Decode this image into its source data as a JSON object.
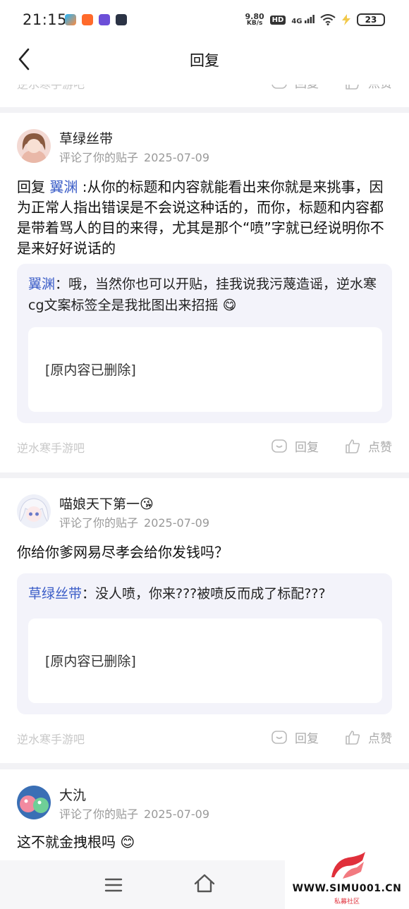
{
  "status": {
    "time": "21:15",
    "net_speed_value": "9.80",
    "net_speed_unit": "KB/s",
    "hd": "HD",
    "signal": "4G",
    "battery": "23"
  },
  "nav": {
    "title": "回复"
  },
  "top_footer": {
    "forum": "逆水寒手游吧",
    "reply": "回复",
    "like": "点赞"
  },
  "posts": [
    {
      "username": "草绿丝带",
      "action": "评论了你的贴子",
      "date": "2025-07-09",
      "body_prefix": "回复 ",
      "mention": "翼渊",
      "body_text": " :从你的标题和内容就能看出来你就是来挑事，因为正常人指出错误是不会说这种话的，而你，标题和内容都是带着骂人的目的来得，尤其是那个“喷”字就已经说明你不是来好好说话的",
      "quote_name": "翼渊",
      "quote_text": "：哦，当然你也可以开贴，挂我说我污蔑造谣，逆水寒cg文案标签全是我批图出来招摇",
      "quote_emoji": "😋",
      "original": "[原内容已删除]",
      "forum": "逆水寒手游吧",
      "reply": "回复",
      "like": "点赞"
    },
    {
      "username": "喵娘天下第一",
      "username_emoji": "😘",
      "action": "评论了你的贴子",
      "date": "2025-07-09",
      "body_text": "你给你爹网易尽孝会给你发钱吗？",
      "quote_name": "草绿丝带",
      "quote_text": "：没人喷，你来???被喷反而成了标配???",
      "original": "[原内容已删除]",
      "forum": "逆水寒手游吧",
      "reply": "回复",
      "like": "点赞"
    },
    {
      "username": "大氿",
      "action": "评论了你的贴子",
      "date": "2025-07-09",
      "body_text": "这不就金拽根吗",
      "body_emoji": "😊"
    }
  ],
  "watermark": {
    "url": "WWW.SIMU001.CN",
    "sub": "私募社区"
  },
  "colors": {
    "accent": "#3a5cc7",
    "quote_bg": "#f3f3fa",
    "divider": "#f2f2f5"
  }
}
